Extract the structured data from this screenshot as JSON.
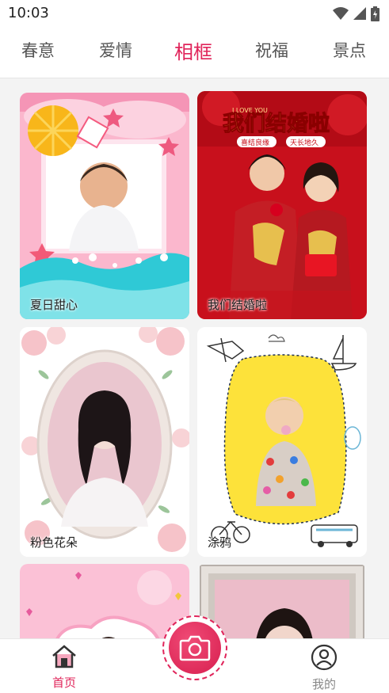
{
  "status": {
    "time": "10:03",
    "icons": [
      "wifi-icon",
      "signal-icon",
      "battery-icon"
    ]
  },
  "tabs": [
    {
      "label": "春意",
      "active": false
    },
    {
      "label": "爱情",
      "active": false
    },
    {
      "label": "相框",
      "active": true
    },
    {
      "label": "祝福",
      "active": false
    },
    {
      "label": "景点",
      "active": false
    }
  ],
  "cards": [
    {
      "label": "夏日甜心"
    },
    {
      "label": "我们结婚啦",
      "banner_title": "我们结婚啦",
      "banner_love": "I LOVE YOU",
      "banner_tag1": "喜结良缘",
      "banner_tag2": "天长地久"
    },
    {
      "label": "粉色花朵"
    },
    {
      "label": "涂鸦"
    }
  ],
  "bottom_nav": {
    "home_label": "首页",
    "mine_label": "我的"
  },
  "colors": {
    "accent": "#e0245a",
    "tab_inactive": "#555555",
    "background": "#f3f3f3"
  }
}
